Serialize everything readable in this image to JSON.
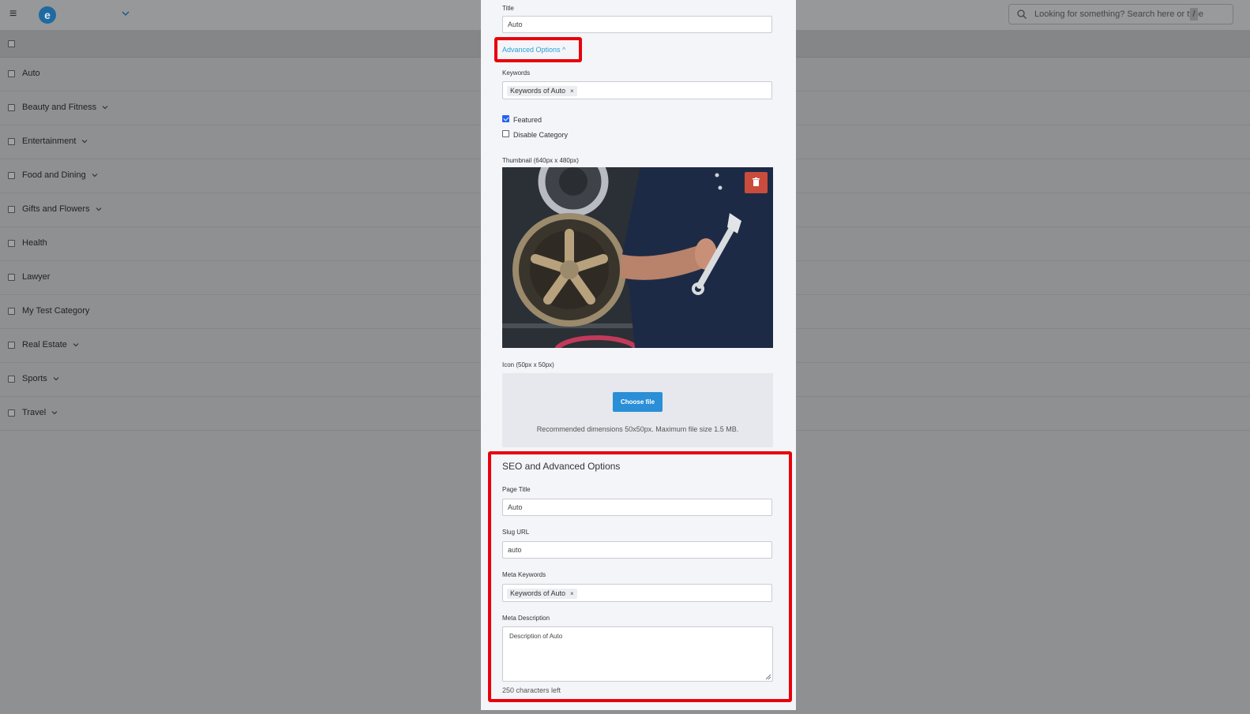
{
  "topbar": {
    "logo_letter": "e",
    "search_placeholder": "Looking for something? Search here or type",
    "search_shortcut": "/"
  },
  "categories": [
    {
      "label": "Auto",
      "has_children": false
    },
    {
      "label": "Beauty and Fitness",
      "has_children": true
    },
    {
      "label": "Entertainment",
      "has_children": true
    },
    {
      "label": "Food and Dining",
      "has_children": true
    },
    {
      "label": "Gifts and Flowers",
      "has_children": true
    },
    {
      "label": "Health",
      "has_children": false
    },
    {
      "label": "Lawyer",
      "has_children": false
    },
    {
      "label": "My Test Category",
      "has_children": false
    },
    {
      "label": "Real Estate",
      "has_children": true
    },
    {
      "label": "Sports",
      "has_children": true
    },
    {
      "label": "Travel",
      "has_children": true
    }
  ],
  "modal": {
    "title_label": "Title",
    "title_value": "Auto",
    "advanced_options_link": "Advanced Options ^",
    "keywords_label": "Keywords",
    "keywords_tag": "Keywords of Auto",
    "tag_remove": "×",
    "featured_label": "Featured",
    "featured_checked": true,
    "disable_label": "Disable Category",
    "disable_checked": false,
    "thumbnail_label": "Thumbnail (640px x 480px)",
    "icon_label": "Icon (50px x 50px)",
    "choose_file": "Choose file",
    "icon_hint": "Recommended dimensions 50x50px. Maximum file size 1.5 MB.",
    "seo_title": "SEO and Advanced Options",
    "page_title_label": "Page Title",
    "page_title_value": "Auto",
    "slug_label": "Slug URL",
    "slug_value": "auto",
    "meta_keywords_label": "Meta Keywords",
    "meta_keywords_tag": "Keywords of Auto",
    "meta_description_label": "Meta Description",
    "meta_description_value": "Description of Auto",
    "chars_left": "250 characters left"
  },
  "colors": {
    "highlight": "#e8000b",
    "link": "#2a9fd6",
    "primary_button": "#2a8fd6",
    "delete_button": "#c94c3d"
  }
}
